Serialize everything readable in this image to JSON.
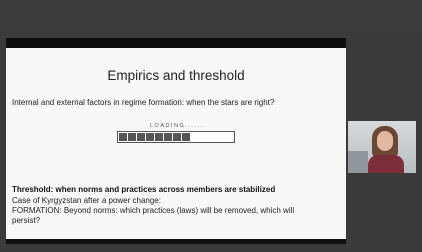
{
  "slide": {
    "title": "Empirics and threshold",
    "subtitle": "Internal and external factors in regime formation: when the stars are right?",
    "loading_label": "LOADING......",
    "loading_progress": 0.8,
    "loading_segments_filled": 8,
    "threshold_heading": "Threshold: when norms and practices across members are stabilized",
    "lines": [
      "Case of Kyrgyzstan after a power change:",
      "FORMATION: Beyond norms: which practices (laws) will be removed, which will",
      "persist?"
    ]
  },
  "participant": {
    "name": ""
  },
  "colors": {
    "background": "#3a3a3a",
    "slide_bg": "#f8f8f6",
    "loading_fill": "#555555"
  }
}
